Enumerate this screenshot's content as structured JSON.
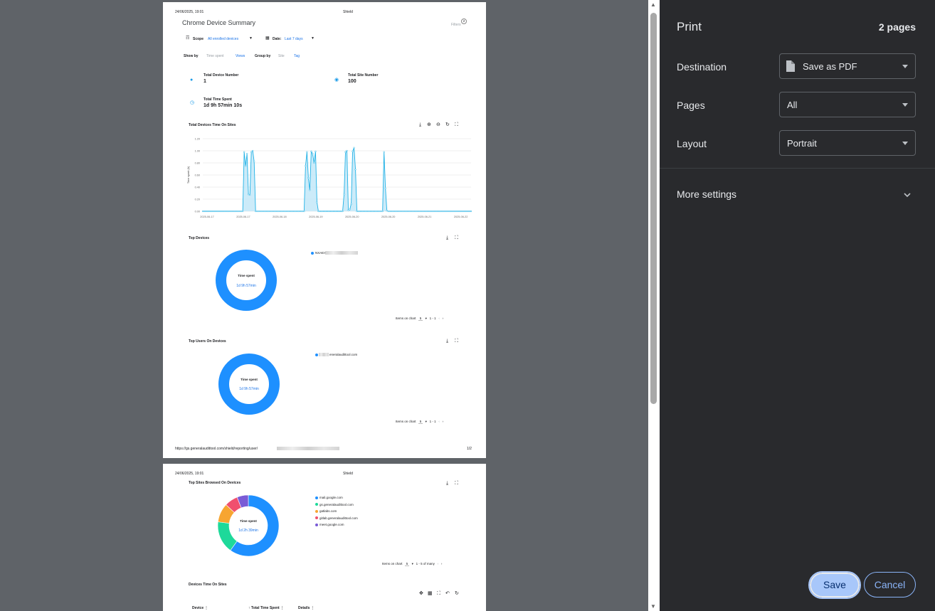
{
  "page1": {
    "date": "24/06/2025, 19:01",
    "app": "Shield",
    "title": "Chrome Device Summary",
    "filters_label": "Filters",
    "filters_count": "2",
    "scope_label": "Scope",
    "scope_value": "All enrolled devices",
    "date_label": "Date:",
    "date_value": "Last 7 days",
    "show_by_label": "Show by",
    "show_by_opt1": "Time spent",
    "show_by_opt2": "Views",
    "group_by_label": "Group by",
    "group_by_opt1": "Site",
    "group_by_opt2": "Tag",
    "stat1_label": "Total Device Number",
    "stat1_value": "1",
    "stat2_label": "Total Site Number",
    "stat2_value": "100",
    "stat3_label": "Total Time Spent",
    "stat3_value": "1d 9h 57min 10s",
    "chart1_title": "Total Devices Time On Sites",
    "top_devices_title": "Top Devices",
    "top_devices_center_label": "Time spent",
    "top_devices_center_value": "1d 9h 57min",
    "top_devices_legend": "NXAEXE",
    "top_devices_items_label": "Items on chart",
    "top_devices_items_value": "5",
    "top_devices_range": "1 - 1",
    "top_users_title": "Top Users On Devices",
    "top_users_center_label": "Time spent",
    "top_users_center_value": "1d 9h 57min",
    "top_users_legend": "eneralaudittool.com",
    "top_users_items_label": "Items on chart",
    "top_users_items_value": "5",
    "top_users_range": "1 - 1",
    "footer_url": "https://gs.generalaudittool.com/shield/reporting/user/",
    "footer_page": "1/2"
  },
  "page2": {
    "date": "24/06/2025, 19:01",
    "app": "Shield",
    "top_sites_title": "Top Sites Browsed On Devices",
    "center_label": "Time spent",
    "center_value": "1d 2h 39min",
    "legend": [
      {
        "label": "mail.google.com",
        "color": "#1e90ff"
      },
      {
        "label": "gs.generalaudittool.com",
        "color": "#1ed99a"
      },
      {
        "label": "gatlabs.com",
        "color": "#f7a531"
      },
      {
        "label": "gitlab.generalaudittool.com",
        "color": "#f0506e"
      },
      {
        "label": "meet.google.com",
        "color": "#7a5bd6"
      }
    ],
    "items_label": "Items on chart",
    "items_value": "5",
    "range": "1 - 5 of many",
    "devices_title": "Devices Time On Sites",
    "col_device": "Device",
    "col_total": "Total Time Spent",
    "col_details": "Details"
  },
  "chart_data": [
    {
      "type": "area",
      "title": "Total Devices Time On Sites",
      "ylabel": "Time spent (h)",
      "ylim": [
        0,
        1.2
      ],
      "y_ticks": [
        "0.00",
        "0.20",
        "0.40",
        "0.60",
        "0.80",
        "1.00",
        "1.20"
      ],
      "x_ticks": [
        "2025-06-17",
        "2025-06-17",
        "2025-06-18",
        "2025-06-19",
        "2025-06-20",
        "2025-06-20",
        "2025-06-21",
        "2025-06-22"
      ],
      "series": [
        {
          "values": [
            0,
            0,
            0,
            0,
            0,
            0,
            0,
            0,
            0,
            0,
            0,
            0,
            0,
            0,
            0,
            0,
            0,
            0,
            0,
            0,
            0,
            0,
            0,
            0,
            0,
            0,
            0,
            0,
            0,
            0.98,
            0.75,
            0.95,
            0.28,
            0.27,
            0.98,
            1.0,
            0.82,
            0,
            0,
            0,
            0,
            0,
            0,
            0,
            0,
            0,
            0,
            0,
            0,
            0,
            0,
            0,
            0,
            0,
            0,
            0,
            0,
            0,
            0,
            0,
            0,
            0,
            0,
            0,
            0,
            0,
            0,
            0,
            0,
            0,
            0,
            0,
            0.75,
            0.98,
            0.55,
            0.35,
            0.99,
            0.95,
            0.8,
            0.99,
            0.15,
            0,
            0,
            0,
            0,
            0,
            0,
            0,
            0,
            0,
            0,
            0,
            0,
            0,
            0,
            0,
            0,
            0,
            0,
            0.28,
            0.98,
            1.0,
            0.02,
            0.03,
            0.12,
            0.99,
            1.05,
            0.69,
            0,
            0,
            0,
            0,
            0,
            0,
            0,
            0,
            0,
            0,
            0,
            0,
            0,
            0,
            0,
            0,
            0,
            0,
            0,
            0.98,
            0.38,
            0.01,
            0,
            0,
            0,
            0,
            0,
            0,
            0,
            0,
            0,
            0,
            0,
            0,
            0,
            0,
            0,
            0,
            0,
            0,
            0,
            0,
            0,
            0,
            0,
            0,
            0,
            0,
            0,
            0,
            0,
            0,
            0,
            0,
            0,
            0,
            0,
            0,
            0,
            0,
            0,
            0,
            0,
            0,
            0,
            0,
            0,
            0,
            0,
            0,
            0,
            0,
            0,
            0,
            0,
            0,
            0,
            0,
            0,
            0,
            0
          ]
        }
      ]
    },
    {
      "type": "pie",
      "title": "Top Devices",
      "categories": [
        "NXAEXE"
      ],
      "values": [
        100
      ]
    },
    {
      "type": "pie",
      "title": "Top Users On Devices",
      "categories": [
        "eneralaudittool.com"
      ],
      "values": [
        100
      ]
    },
    {
      "type": "pie",
      "title": "Top Sites Browsed On Devices",
      "categories": [
        "mail.google.com",
        "gs.generalaudittool.com",
        "gatlabs.com",
        "gitlab.generalaudittool.com",
        "meet.google.com"
      ],
      "values": [
        60,
        17,
        10,
        7,
        6
      ]
    }
  ],
  "panel": {
    "title": "Print",
    "pages_count": "2 pages",
    "destination_label": "Destination",
    "destination_value": "Save as PDF",
    "pages_label": "Pages",
    "pages_value": "All",
    "layout_label": "Layout",
    "layout_value": "Portrait",
    "more_settings": "More settings",
    "save": "Save",
    "cancel": "Cancel"
  }
}
